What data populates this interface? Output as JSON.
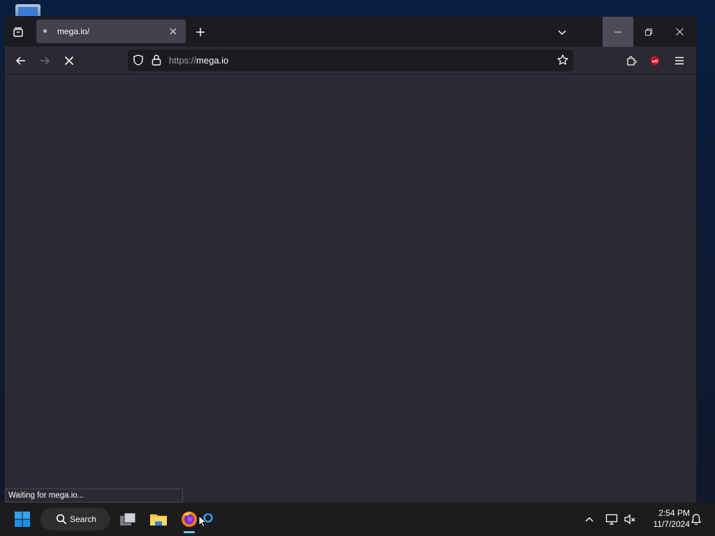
{
  "window": {
    "tab": {
      "title": "mega.io/"
    },
    "url": {
      "scheme": "https://",
      "host": "mega.io"
    },
    "status": "Waiting for mega.io..."
  },
  "taskbar": {
    "search_label": "Search",
    "time": "2:54 PM",
    "date": "11/7/2024"
  },
  "colors": {
    "browser_bg": "#2b2a33",
    "tabbar_bg": "#1c1b22",
    "active_tab": "#42414d",
    "taskbar_bg": "#1c1c1e",
    "accent": "#60cdff",
    "ublock_red": "#c1121f"
  },
  "icons": {
    "tab_list": "tab-list-icon",
    "new_tab": "plus-icon",
    "all_tabs": "chevron-down-icon",
    "back": "back-arrow-icon",
    "forward": "forward-arrow-icon",
    "stop": "stop-icon",
    "tracking": "shield-icon",
    "lock": "lock-icon",
    "bookmark": "star-icon",
    "extensions": "puzzle-icon",
    "ublock": "ublock-origin-icon",
    "menu": "hamburger-menu-icon"
  }
}
